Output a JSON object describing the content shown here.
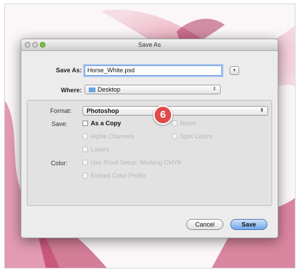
{
  "dialog": {
    "title": "Save As",
    "save_as_label": "Save As:",
    "filename": "Horse_White.psd",
    "expand_icon": "triangle-down-icon",
    "where_label": "Where:",
    "where_value": "Desktop"
  },
  "panel": {
    "format_label": "Format:",
    "format_value": "Photoshop",
    "save_label": "Save:",
    "color_label": "Color:",
    "options": {
      "as_a_copy": "As a Copy",
      "notes": "Notes",
      "alpha_channels": "Alpha Channels",
      "spot_colors": "Spot Colors",
      "layers": "Layers",
      "use_proof_setup": "Use Proof Setup:  Working CMYK",
      "embed_color_profile": "Embed Color Profile"
    }
  },
  "buttons": {
    "cancel": "Cancel",
    "save": "Save"
  },
  "badge": {
    "number": "6",
    "color": "#e04a4a"
  },
  "colors": {
    "background_art": "#c8365f",
    "focus_ring": "#a9c8f0",
    "default_button": "#6ea7e8"
  }
}
